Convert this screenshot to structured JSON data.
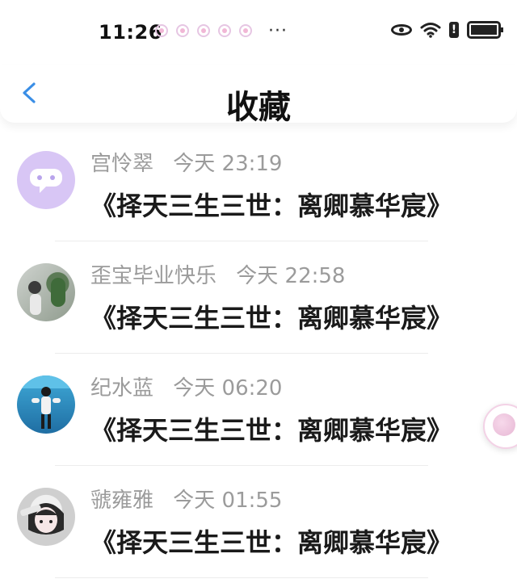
{
  "status_bar": {
    "time": "11:26",
    "more": "···",
    "icons": [
      "heart-icon",
      "heart-icon",
      "heart-icon",
      "heart-icon",
      "heart-icon",
      "eye-icon",
      "wifi-icon",
      "alert-icon",
      "battery-icon"
    ]
  },
  "header": {
    "title": "收藏",
    "back_icon": "chevron-left-icon"
  },
  "items": [
    {
      "name": "宫怜翠",
      "time": "今天 23:19",
      "message": "《择天三生三世：离卿慕华宸》",
      "avatar": "purple-chat-avatar"
    },
    {
      "name": "歪宝毕业快乐",
      "time": "今天 22:58",
      "message": "《择天三生三世：离卿慕华宸》",
      "avatar": "photo-girl-avatar"
    },
    {
      "name": "纪水蓝",
      "time": "今天 06:20",
      "message": "《择天三生三世：离卿慕华宸》",
      "avatar": "photo-jump-avatar"
    },
    {
      "name": "虢雍雅",
      "time": "今天 01:55",
      "message": "《择天三生三世：离卿慕华宸》",
      "avatar": "anime-boy-avatar"
    }
  ],
  "colors": {
    "accent": "#3a8ee6",
    "muted": "#9b9b9b",
    "avatar_purple": "#d8c6f5"
  }
}
